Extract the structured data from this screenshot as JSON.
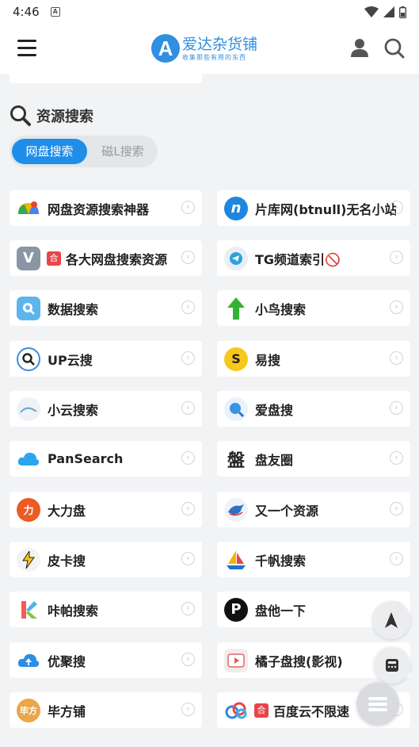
{
  "status_bar": {
    "time": "4:46",
    "sim_label": "A"
  },
  "app": {
    "name": "爱达杂货铺",
    "slogan": "收集那些有用的东西",
    "logo_letter": "A"
  },
  "section": {
    "title": "资源搜索"
  },
  "tabs": [
    {
      "label": "网盘搜索",
      "active": true
    },
    {
      "label": "磁L搜索",
      "active": false
    }
  ],
  "tiles": [
    {
      "label": "网盘资源搜索神器",
      "icon": "google-drive-icon",
      "tag": ""
    },
    {
      "label": "片库网(btnull)无名小站",
      "icon": "letter-n-icon",
      "tag": ""
    },
    {
      "label": "各大网盘搜索资源",
      "icon": "letter-v-icon",
      "tag": "合"
    },
    {
      "label": "TG频道索引🚫",
      "icon": "telegram-icon",
      "tag": ""
    },
    {
      "label": "数据搜索",
      "icon": "data-search-icon",
      "tag": ""
    },
    {
      "label": "小鸟搜索",
      "icon": "green-arrow-icon",
      "tag": ""
    },
    {
      "label": "UP云搜",
      "icon": "magnifier-icon",
      "tag": ""
    },
    {
      "label": "易搜",
      "icon": "yisou-icon",
      "tag": ""
    },
    {
      "label": "小云搜索",
      "icon": "cloud-icon",
      "tag": ""
    },
    {
      "label": "爱盘搜",
      "icon": "blue-search-icon",
      "tag": ""
    },
    {
      "label": "PanSearch",
      "icon": "pansearch-cloud-icon",
      "tag": ""
    },
    {
      "label": "盘友圈",
      "icon": "pan-character-icon",
      "tag": ""
    },
    {
      "label": "大力盘",
      "icon": "dalipan-icon",
      "tag": ""
    },
    {
      "label": "又一个资源",
      "icon": "dolphin-icon",
      "tag": ""
    },
    {
      "label": "皮卡搜",
      "icon": "lightning-icon",
      "tag": ""
    },
    {
      "label": "千帆搜索",
      "icon": "sailboat-icon",
      "tag": ""
    },
    {
      "label": "咔帕搜索",
      "icon": "letter-k-icon",
      "tag": ""
    },
    {
      "label": "盘他一下",
      "icon": "letter-p-icon",
      "tag": ""
    },
    {
      "label": "优聚搜",
      "icon": "upload-cloud-icon",
      "tag": ""
    },
    {
      "label": "橘子盘搜(影视)",
      "icon": "play-icon",
      "tag": ""
    },
    {
      "label": "毕方铺",
      "icon": "bifang-icon",
      "tag": ""
    },
    {
      "label": "百度云不限速",
      "icon": "baidu-cloud-icon",
      "tag": "合"
    }
  ],
  "colors": {
    "accent": "#1f8ee8",
    "tag_red": "#e8454a",
    "background": "#f2f3f5"
  }
}
